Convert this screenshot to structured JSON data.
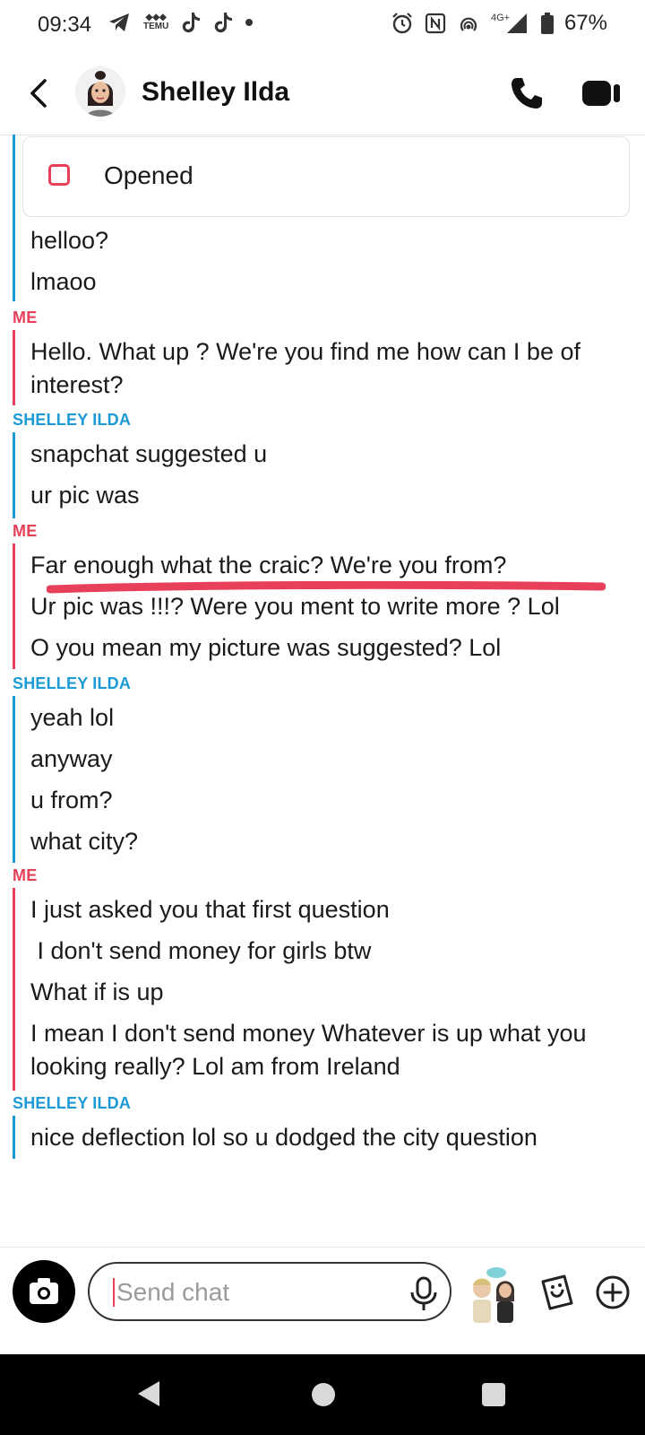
{
  "status_bar": {
    "time": "09:34",
    "temu_label": "TEMU",
    "network": "4G+",
    "battery": "67%",
    "icons": [
      "telegram-icon",
      "temu-icon",
      "tiktok-icon",
      "tiktok-icon",
      "alarm-icon",
      "nfc-icon",
      "hotspot-icon",
      "signal-icon",
      "battery-icon"
    ]
  },
  "header": {
    "contact_name": "Shelley Ilda",
    "icons": [
      "back-chevron-icon",
      "avatar",
      "phone-icon",
      "video-icon"
    ]
  },
  "opened_notice": {
    "label": "Opened"
  },
  "senders": {
    "me": "ME",
    "them": "SHELLEY ILDA"
  },
  "messages": [
    {
      "text": "helloo?"
    },
    {
      "text": "lmaoo"
    },
    {
      "text": "Hello. What up ? We're you find me how can I be of interest?"
    },
    {
      "text": "snapchat suggested u"
    },
    {
      "text": "ur pic was"
    },
    {
      "text": "Far enough what the craic? We're you from?"
    },
    {
      "text": "Ur pic was !!!? Were you ment to write more ? Lol"
    },
    {
      "text": "O you mean my picture was suggested? Lol"
    },
    {
      "text": "yeah lol"
    },
    {
      "text": "anyway"
    },
    {
      "text": "u from?"
    },
    {
      "text": "what city?"
    },
    {
      "text": "I just asked you that first question"
    },
    {
      "text": " I don't send money for girls btw"
    },
    {
      "text": "What if is up"
    },
    {
      "text": "I mean I don't send money Whatever is up what you looking really? Lol am from Ireland"
    },
    {
      "text": "nice deflection lol so u dodged the city question"
    }
  ],
  "input": {
    "placeholder": "Send chat",
    "value": ""
  },
  "colors": {
    "me": "#e8405a",
    "them": "#1c9ad6",
    "underline": "#e8405a"
  }
}
